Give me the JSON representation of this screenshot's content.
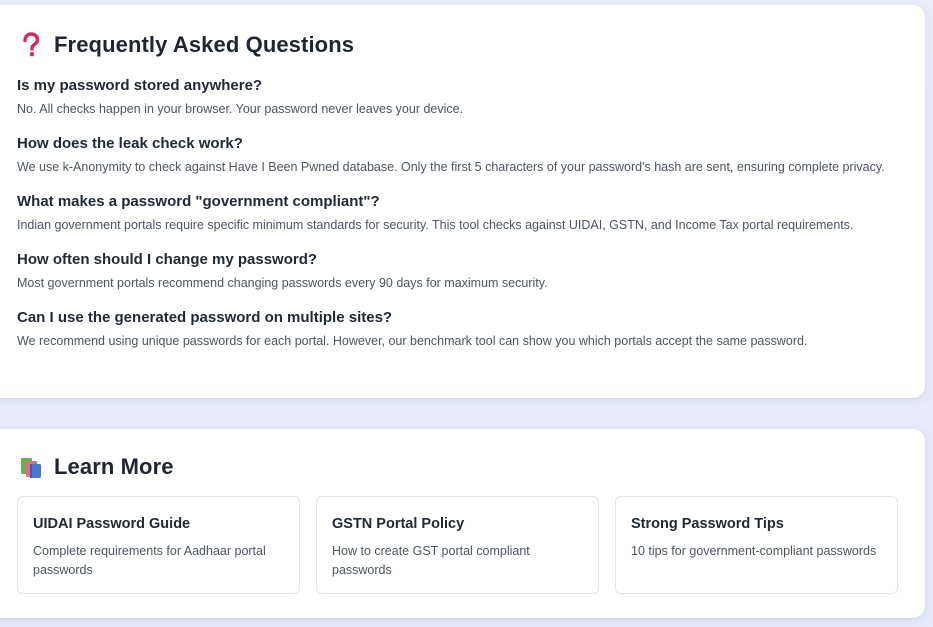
{
  "faq": {
    "icon": "question-mark-icon",
    "title": "Frequently Asked Questions",
    "items": [
      {
        "question": "Is my password stored anywhere?",
        "answer": "No. All checks happen in your browser. Your password never leaves your device."
      },
      {
        "question": "How does the leak check work?",
        "answer": "We use k-Anonymity to check against Have I Been Pwned database. Only the first 5 characters of your password's hash are sent, ensuring complete privacy."
      },
      {
        "question": "What makes a password \"government compliant\"?",
        "answer": "Indian government portals require specific minimum standards for security. This tool checks against UIDAI, GSTN, and Income Tax portal requirements."
      },
      {
        "question": "How often should I change my password?",
        "answer": "Most government portals recommend changing passwords every 90 days for maximum security."
      },
      {
        "question": "Can I use the generated password on multiple sites?",
        "answer": "We recommend using unique passwords for each portal. However, our benchmark tool can show you which portals accept the same password."
      }
    ]
  },
  "learn_more": {
    "icon": "books-icon",
    "title": "Learn More",
    "resources": [
      {
        "title": "UIDAI Password Guide",
        "description": "Complete requirements for Aadhaar portal passwords"
      },
      {
        "title": "GSTN Portal Policy",
        "description": "How to create GST portal compliant passwords"
      },
      {
        "title": "Strong Password Tips",
        "description": "10 tips for government-compliant passwords"
      }
    ]
  },
  "colors": {
    "page_background": "#e8ecfb",
    "card_background": "#ffffff",
    "heading_text": "#1e2533",
    "body_text": "#4b5563",
    "question_icon": "#e0245e",
    "card_border": "#e2e5ec"
  }
}
